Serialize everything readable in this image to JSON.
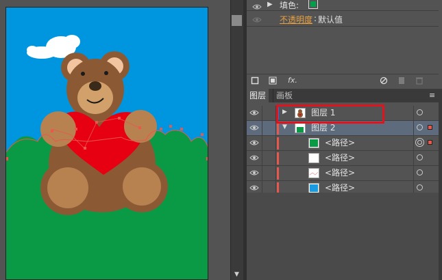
{
  "appearance": {
    "fill_label": "填色:",
    "opacity_label": "不透明度",
    "opacity_sep": ":",
    "opacity_value": "默认值",
    "fill_color": "#00a04a",
    "opacity_link_color": "#e8a040"
  },
  "toolbar": {
    "fx_label": "fx."
  },
  "panel_tabs": {
    "layers": "图层",
    "artboards": "画板",
    "menu_icon": "≡"
  },
  "layers": [
    {
      "name": "图层 1",
      "expand": "right",
      "highlight_color": "#3b6bd6",
      "thumb": "bear"
    },
    {
      "name": "图层 2",
      "expand": "down",
      "highlight_color": "#e8584c",
      "thumb": "green"
    }
  ],
  "paths": [
    {
      "name": "<路径>",
      "thumb_color": "#0a9a45"
    },
    {
      "name": "<路径>",
      "thumb_color": "#ffffff"
    },
    {
      "name": "<路径>",
      "thumb_color": "#f4f4f4"
    },
    {
      "name": "<路径>",
      "thumb_color": "#1a9ae0"
    }
  ],
  "colors": {
    "sky": "#0096df",
    "grass": "#0a9a45",
    "bear_dark": "#8b5a35",
    "bear_light": "#b88150",
    "heart": "#e60012",
    "highlight": "#e0141e"
  }
}
